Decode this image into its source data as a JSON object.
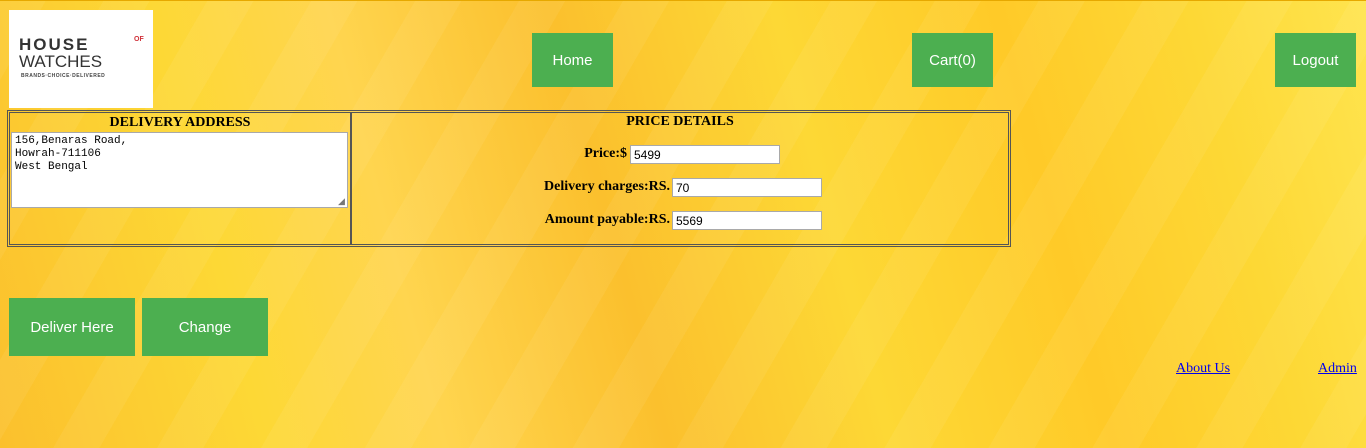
{
  "logo": {
    "line1": "HOUSE",
    "of": "OF",
    "line2": "WATCHES",
    "tagline": "BRANDS·CHOICE·DELIVERED"
  },
  "nav": {
    "home_label": "Home",
    "cart_label": "Cart(0)",
    "logout_label": "Logout"
  },
  "delivery": {
    "title": "DELIVERY ADDRESS",
    "address": "156,Benaras Road,\nHowrah-711106\nWest Bengal"
  },
  "price_details": {
    "title": "PRICE DETAILS",
    "price_label": "Price:$",
    "price_value": "5499",
    "delivery_label": "Delivery charges:RS.",
    "delivery_value": "70",
    "amount_label": "Amount payable:RS.",
    "amount_value": "5569"
  },
  "actions": {
    "deliver_label": "Deliver Here",
    "change_label": "Change"
  },
  "footer": {
    "about_label": "About Us",
    "admin_label": "Admin"
  },
  "colors": {
    "button": "#4caf50",
    "background": "#fdd835",
    "link": "#0000ee"
  }
}
